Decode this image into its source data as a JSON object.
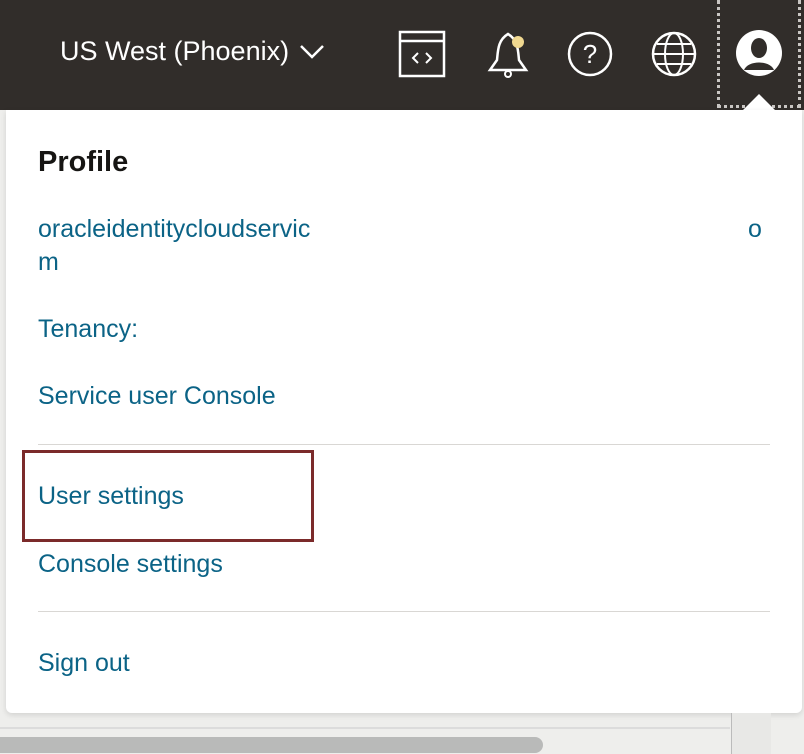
{
  "header": {
    "region_label": "US West (Phoenix)",
    "icons": [
      "code-editor-icon",
      "bell-icon",
      "help-icon",
      "globe-icon",
      "profile-avatar-icon"
    ],
    "notification_dot_color": "#f0d890"
  },
  "profile_menu": {
    "title": "Profile",
    "username_start": "oracleidentitycloudservic",
    "username_end": "o",
    "username_wrap": "m",
    "tenancy_label": "Tenancy:",
    "service_console": "Service user Console",
    "user_settings": "User settings",
    "console_settings": "Console settings",
    "sign_out": "Sign out",
    "link_color": "#0b6386",
    "highlight_color": "#7b2a2a"
  }
}
